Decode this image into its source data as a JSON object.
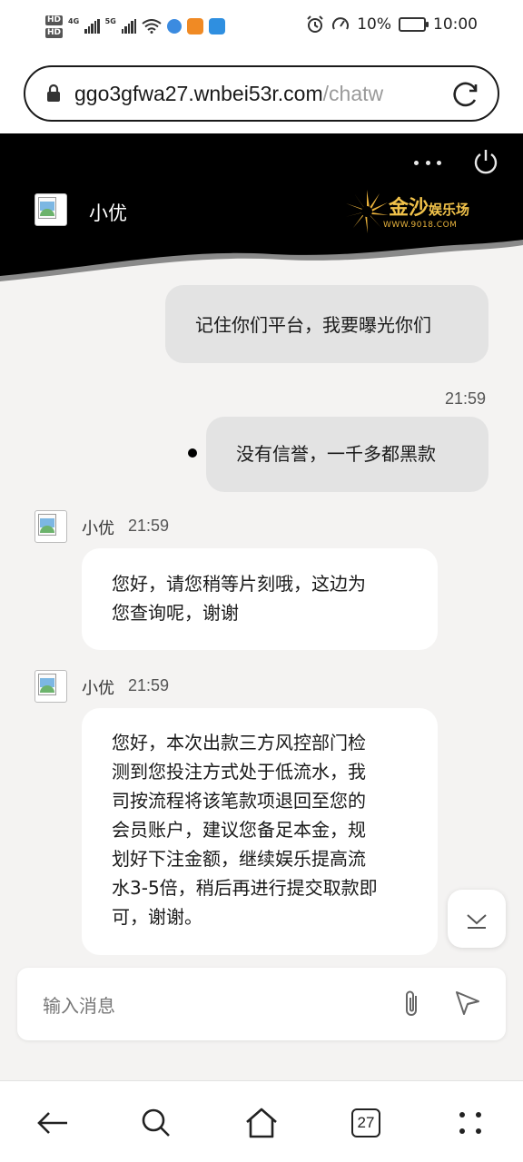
{
  "status_bar": {
    "hd1": "HD",
    "hd2": "HD",
    "net1": "4G",
    "net2": "5G",
    "battery_percent": "10%",
    "time": "10:00"
  },
  "browser": {
    "url_main": "ggo3gfwa27.wnbei53r.com",
    "url_path": "/chatw"
  },
  "chat_header": {
    "agent_name": "小优",
    "logo_text_main": "金沙",
    "logo_text_small": "娱乐场",
    "logo_sub": "WWW.9018.COM"
  },
  "messages": [
    {
      "direction": "out",
      "text": "记住你们平台，我要曝光你们"
    },
    {
      "direction": "out",
      "time": "21:59",
      "text": "没有信誉，一千多都黑款"
    },
    {
      "direction": "in",
      "sender": "小优",
      "time": "21:59",
      "lines": [
        "您好，请您稍等片刻哦，这边为",
        "您查询呢，谢谢"
      ]
    },
    {
      "direction": "in",
      "sender": "小优",
      "time": "21:59",
      "lines": [
        "您好，本次出款三方风控部门检",
        "测到您投注方式处于低流水，我",
        "司按流程将该笔款项退回至您的",
        "会员账户，建议您备足本金，规",
        "划好下注金额，继续娱乐提高流",
        "水3-5倍，稍后再进行提交取款即",
        "可，谢谢。"
      ]
    }
  ],
  "composer": {
    "placeholder": "输入消息"
  },
  "bottom_nav": {
    "tab_count": "27"
  }
}
